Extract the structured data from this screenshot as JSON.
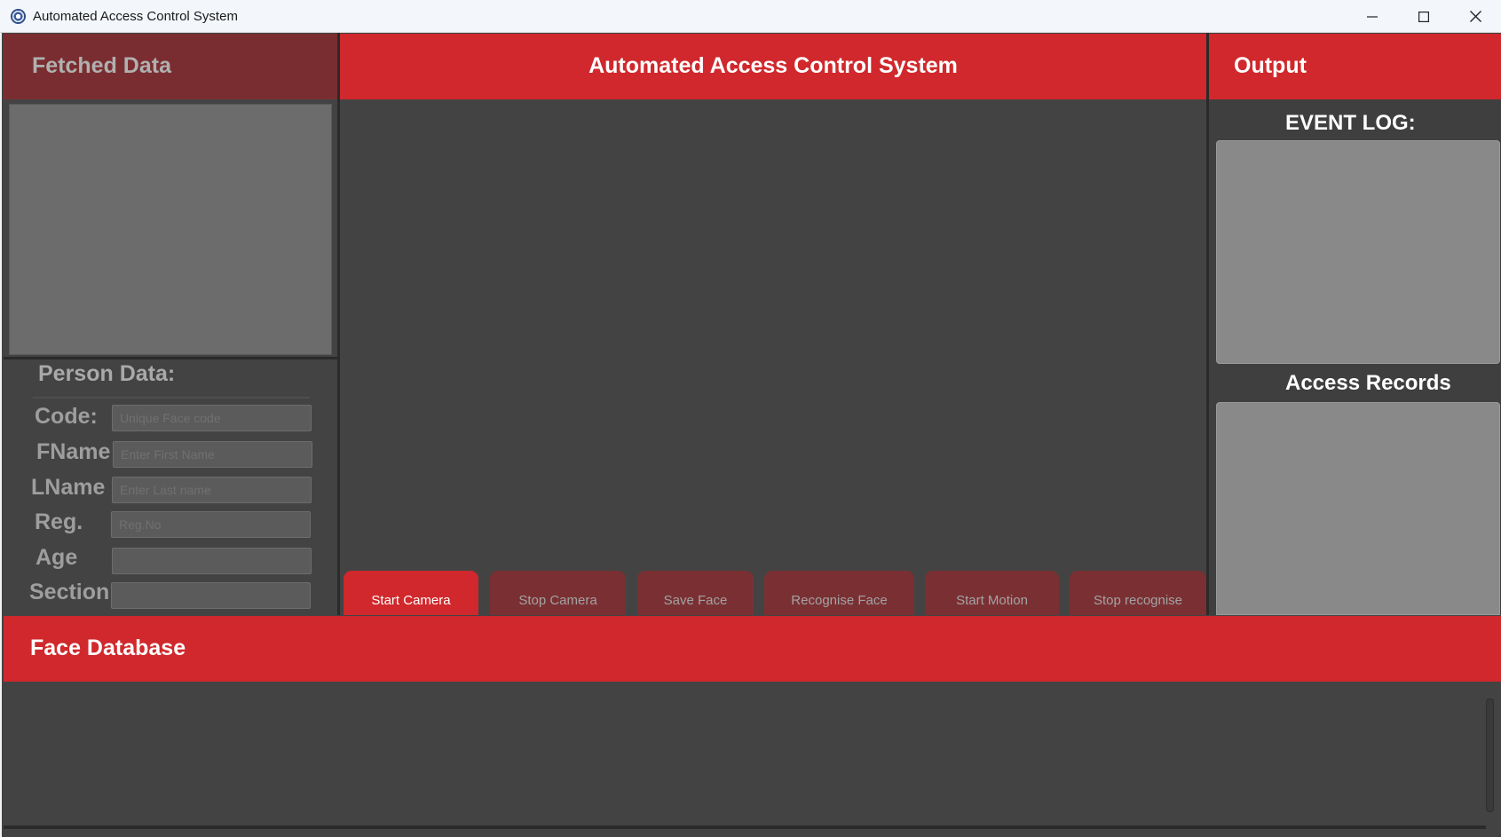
{
  "window": {
    "title": "Automated Access Control System",
    "minimize_icon": "minimize-icon",
    "maximize_icon": "maximize-icon",
    "close_icon": "close-icon"
  },
  "left": {
    "header": "Fetched Data",
    "person_title": "Person Data:",
    "fields": [
      {
        "label": "Code:",
        "placeholder": "Unique Face code"
      },
      {
        "label": "FName",
        "placeholder": "Enter First Name"
      },
      {
        "label": "LName",
        "placeholder": "Enter Last name"
      },
      {
        "label": "Reg.",
        "placeholder": "Reg.No"
      },
      {
        "label": "Age",
        "placeholder": ""
      },
      {
        "label": "Section",
        "placeholder": ""
      }
    ]
  },
  "center": {
    "header": "Automated Access Control System",
    "buttons": [
      {
        "label": "Start Camera"
      },
      {
        "label": "Stop Camera"
      },
      {
        "label": "Save Face"
      },
      {
        "label": "Recognise Face"
      },
      {
        "label": "Start Motion"
      },
      {
        "label": "Stop recognise"
      }
    ]
  },
  "right": {
    "header": "Output",
    "event_log_title": "EVENT LOG:",
    "access_records_title": "Access Records"
  },
  "bottom": {
    "header": "Face Database"
  },
  "colors": {
    "accent_red": "#d0282c",
    "dim_red": "#7a2d30",
    "panel_bg": "#434343"
  }
}
